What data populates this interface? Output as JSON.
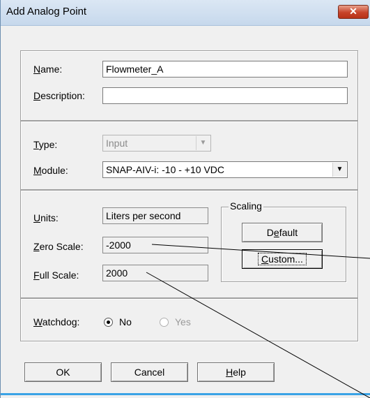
{
  "window": {
    "title": "Add Analog Point",
    "close_symbol": "✕"
  },
  "fields": {
    "name_label_hot": "N",
    "name_label_rest": "ame:",
    "name_value": "Flowmeter_A",
    "description_label_hot": "D",
    "description_label_rest": "escription:",
    "description_value": "",
    "type_label_hot": "T",
    "type_label_rest": "ype:",
    "type_value": "Input",
    "module_label_hot": "M",
    "module_label_rest": "odule:",
    "module_value": "SNAP-AIV-i: -10 - +10 VDC",
    "units_label_hot": "U",
    "units_label_rest": "nits:",
    "units_value": "Liters per second",
    "zero_label_hot": "Z",
    "zero_label_rest": "ero Scale:",
    "zero_value": "-2000",
    "full_label_hot": "F",
    "full_label_rest": "ull Scale:",
    "full_value": "2000"
  },
  "scaling": {
    "label": "Scaling",
    "default_pre": "D",
    "default_hot": "e",
    "default_rest": "fault",
    "custom_hot": "C",
    "custom_rest": "ustom..."
  },
  "watchdog": {
    "label_hot": "W",
    "label_rest": "atchdog:",
    "no_label": "No",
    "yes_label": "Yes"
  },
  "buttons": {
    "ok": "OK",
    "cancel": "Cancel",
    "help_hot": "H",
    "help_rest": "elp"
  },
  "icons": {
    "dropdown": "▼"
  }
}
